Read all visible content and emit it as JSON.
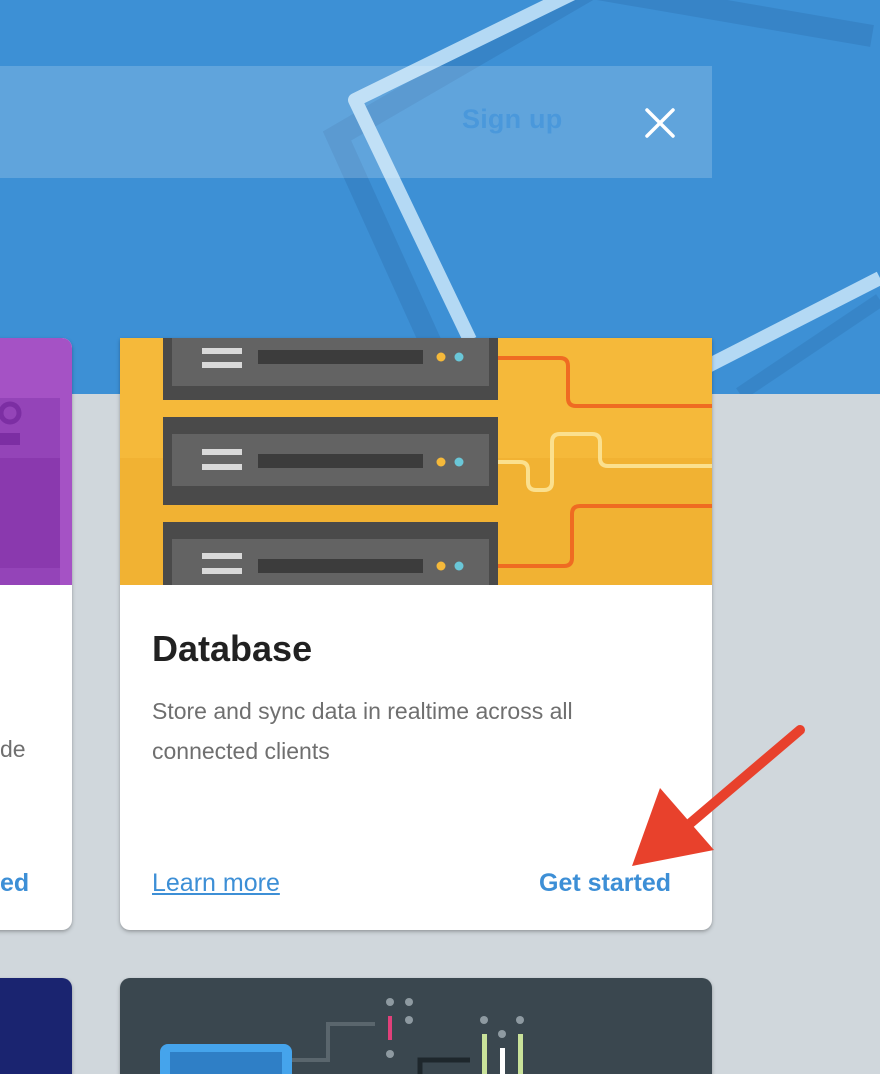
{
  "header": {
    "signup_label": "Sign up",
    "close_icon": "close-icon",
    "accent": "#3d90d5"
  },
  "cards": {
    "database": {
      "title": "Database",
      "description": "Store and sync data in realtime across all connected clients",
      "learn_more": "Learn more",
      "get_started": "Get started",
      "image": "server-rack-illustration"
    },
    "left_fragment": {
      "text_fragment": "de",
      "link_fragment": "ed"
    }
  },
  "annotation": {
    "arrow_color": "#e8412c",
    "arrow_icon": "red-arrow-pointer"
  }
}
